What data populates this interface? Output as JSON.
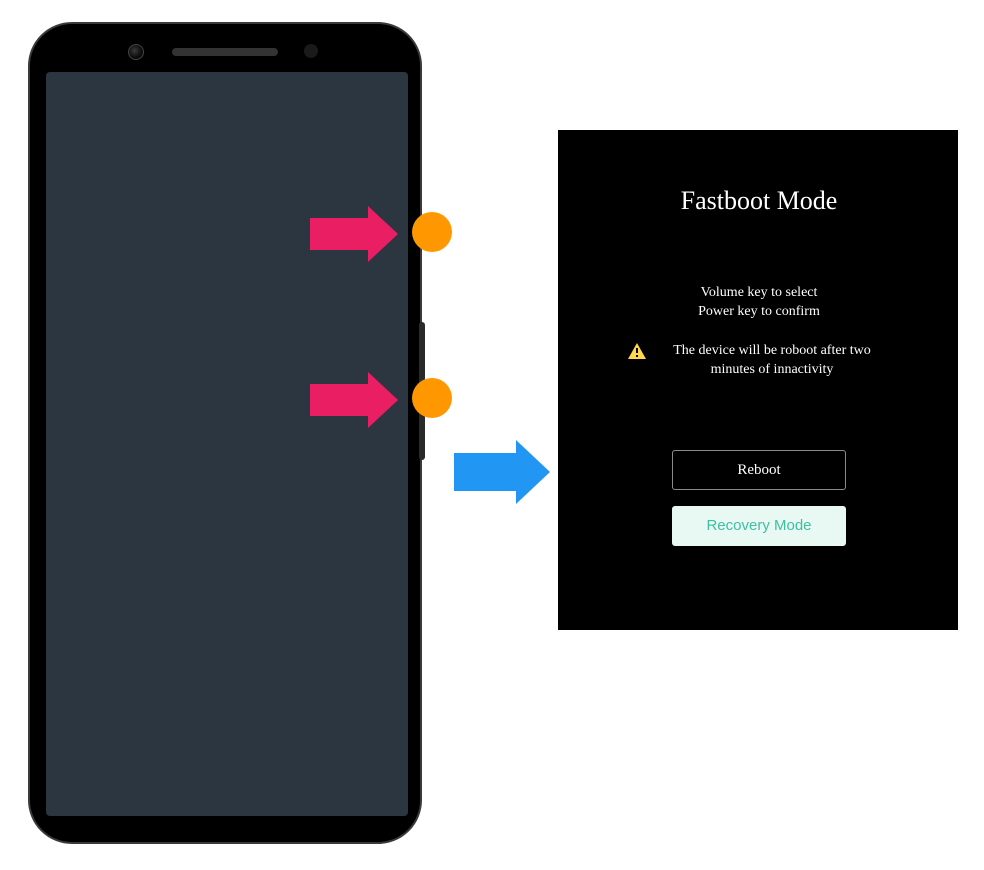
{
  "fastboot": {
    "title": "Fastboot Mode",
    "instructions_line1": "Volume key to select",
    "instructions_line2": "Power key to confirm",
    "warning": "The device will be roboot after two minutes of innactivity",
    "buttons": {
      "reboot": "Reboot",
      "recovery": "Recovery Mode"
    }
  },
  "annotations": {
    "arrow_volume_up": "pink-arrow",
    "arrow_volume_down": "pink-arrow",
    "arrow_result": "blue-arrow",
    "dot_volume_up": "orange-dot",
    "dot_power": "orange-dot"
  },
  "colors": {
    "pink": "#E91E63",
    "blue": "#2196F3",
    "orange": "#FF9800",
    "teal": "#3fbfa3",
    "mint": "#e8f8f2",
    "screen": "#2c3640"
  }
}
